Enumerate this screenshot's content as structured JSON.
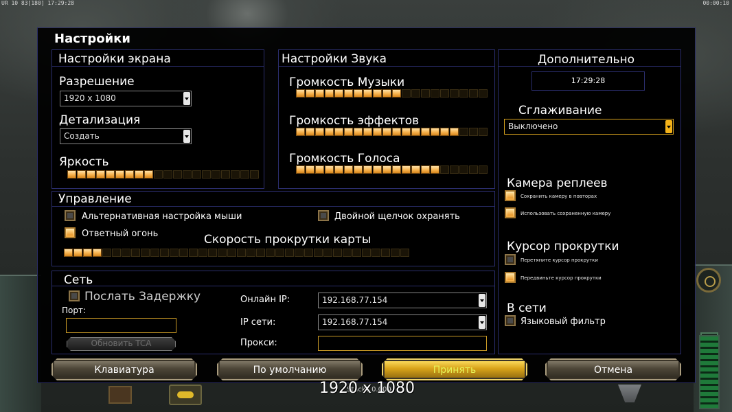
{
  "hud": {
    "top_left": "UR 10  83[180]  17:29:28",
    "top_right": "00:00:10"
  },
  "dialog": {
    "title": "Настройки"
  },
  "screen": {
    "title": "Настройки экрана",
    "resolution_label": "Разрешение",
    "resolution_value": "1920 x 1080",
    "detail_label": "Детализация",
    "detail_value": "Создать",
    "brightness_label": "Яркость",
    "brightness_level": 9,
    "brightness_total": 20
  },
  "sound": {
    "title": "Настройки Звука",
    "music_label": "Громкость Музыки",
    "music_level": 11,
    "music_total": 20,
    "effects_label": "Громкость эффектов",
    "effects_level": 17,
    "effects_total": 20,
    "voice_label": "Громкость Голоса",
    "voice_level": 15,
    "voice_total": 20
  },
  "extra": {
    "title": "Дополнительно",
    "clock": "17:29:28",
    "antialias_label": "Сглаживание",
    "antialias_value": "Выключено",
    "replay_camera_title": "Камера реплеев",
    "replay_save_label": "Сохранить камеру в повторах",
    "replay_use_label": "Использовать сохраненную камеру",
    "scroll_cursor_title": "Курсор прокрутки",
    "scroll_drag_label": "Перетяните курсор прокрутки",
    "scroll_move_label": "Передвиньте курсор прокрутки",
    "online_title": "В сети",
    "lang_filter_label": "Языковый фильтр"
  },
  "controls": {
    "title": "Управление",
    "alt_mouse_label": "Альтернативная настройка мыши",
    "double_click_label": "Двойной щелчок охранять",
    "return_fire_label": "Ответный огонь",
    "scroll_speed_label": "Скорость прокрутки карты",
    "scroll_speed_level": 4,
    "scroll_speed_total": 36
  },
  "network": {
    "title": "Сеть",
    "send_latency_label": "Послать Задержку",
    "port_label": "Порт:",
    "port_value": "",
    "update_tca_label": "Обновить TCA",
    "online_ip_label": "Онлайн IP:",
    "online_ip_value": "192.168.77.154",
    "lan_ip_label": "IP сети:",
    "lan_ip_value": "192.168.77.154",
    "proxy_label": "Прокси:",
    "proxy_value": ""
  },
  "buttons": {
    "keyboard": "Клавиатура",
    "defaults": "По умолчанию",
    "accept": "Принять",
    "cancel": "Отмена"
  },
  "overlay": {
    "resolution_caption": "1920 x 1080",
    "small_text": "Stacks 0.0004"
  },
  "colors": {
    "panel_border": "#2b2e6e",
    "slider_on": "#f7b24d",
    "accent_gold": "#d6a21e",
    "accept_text": "#e6f55a"
  }
}
